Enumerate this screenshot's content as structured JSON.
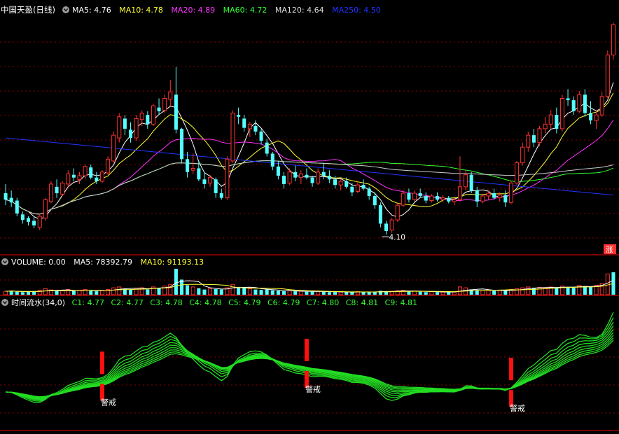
{
  "header": {
    "stock_name": "中国天盈(日线)",
    "ma_items": [
      {
        "label": "MA5: 4.76",
        "color": "#ffffff"
      },
      {
        "label": "MA10: 4.78",
        "color": "#ffff33"
      },
      {
        "label": "MA20: 4.89",
        "color": "#ff33ff"
      },
      {
        "label": "MA60: 4.72",
        "color": "#33ff33"
      },
      {
        "label": "MA120: 4.64",
        "color": "#dddddd"
      },
      {
        "label": "MA250: 4.50",
        "color": "#2233ff"
      }
    ]
  },
  "volume_header": {
    "title": "VOLUME: 0.00",
    "items": [
      {
        "label": "MA5: 78392.79",
        "color": "#ffffff"
      },
      {
        "label": "MA10: 91193.13",
        "color": "#ffff33"
      }
    ]
  },
  "indicator_header": {
    "title": "时间流水(34,0)",
    "items": [
      {
        "label": "C1: 4.77",
        "color": "#33ff33"
      },
      {
        "label": "C2: 4.77",
        "color": "#33ff33"
      },
      {
        "label": "C3: 4.78",
        "color": "#33ff33"
      },
      {
        "label": "C4: 4.78",
        "color": "#33ff33"
      },
      {
        "label": "C5: 4.79",
        "color": "#33ff33"
      },
      {
        "label": "C6: 4.79",
        "color": "#33ff33"
      },
      {
        "label": "C7: 4.80",
        "color": "#33ff33"
      },
      {
        "label": "C8: 4.81",
        "color": "#33ff33"
      },
      {
        "label": "C9: 4.81",
        "color": "#33ff33"
      }
    ]
  },
  "zhang_badge": "涨",
  "low_marker": "4.10",
  "colors": {
    "up": "#ff3232",
    "down": "#54ffff",
    "grid": "#8b0000",
    "ind": "#22dd22"
  },
  "chart_data": {
    "type": "candlestick",
    "ylim": [
      3.95,
      6.45
    ],
    "candles": [
      [
        4.55,
        4.65,
        4.42,
        4.48
      ],
      [
        4.5,
        4.58,
        4.4,
        4.45
      ],
      [
        4.47,
        4.5,
        4.3,
        4.33
      ],
      [
        4.32,
        4.35,
        4.22,
        4.26
      ],
      [
        4.28,
        4.3,
        4.2,
        4.24
      ],
      [
        4.25,
        4.3,
        4.17,
        4.2
      ],
      [
        4.18,
        4.33,
        4.15,
        4.3
      ],
      [
        4.28,
        4.5,
        4.25,
        4.48
      ],
      [
        4.46,
        4.68,
        4.44,
        4.65
      ],
      [
        4.62,
        4.7,
        4.5,
        4.55
      ],
      [
        4.54,
        4.68,
        4.52,
        4.66
      ],
      [
        4.65,
        4.8,
        4.62,
        4.76
      ],
      [
        4.75,
        4.82,
        4.68,
        4.72
      ],
      [
        4.7,
        4.78,
        4.65,
        4.74
      ],
      [
        4.74,
        4.86,
        4.7,
        4.84
      ],
      [
        4.83,
        4.86,
        4.7,
        4.72
      ],
      [
        4.72,
        4.78,
        4.65,
        4.68
      ],
      [
        4.68,
        4.8,
        4.66,
        4.78
      ],
      [
        4.77,
        4.95,
        4.75,
        4.92
      ],
      [
        4.9,
        5.22,
        4.88,
        5.18
      ],
      [
        5.15,
        5.42,
        5.1,
        5.38
      ],
      [
        5.36,
        5.4,
        5.18,
        5.25
      ],
      [
        5.24,
        5.32,
        5.1,
        5.15
      ],
      [
        5.15,
        5.4,
        5.12,
        5.36
      ],
      [
        5.35,
        5.45,
        5.28,
        5.42
      ],
      [
        5.4,
        5.44,
        5.25,
        5.3
      ],
      [
        5.3,
        5.52,
        5.28,
        5.5
      ],
      [
        5.48,
        5.58,
        5.4,
        5.44
      ],
      [
        5.45,
        5.62,
        5.42,
        5.58
      ],
      [
        5.57,
        5.78,
        5.5,
        5.65
      ],
      [
        5.62,
        5.92,
        5.2,
        5.24
      ],
      [
        5.25,
        5.26,
        4.88,
        4.92
      ],
      [
        4.92,
        5.0,
        4.72,
        4.78
      ],
      [
        4.8,
        4.98,
        4.76,
        4.82
      ],
      [
        4.82,
        4.9,
        4.68,
        4.7
      ],
      [
        4.7,
        4.78,
        4.6,
        4.65
      ],
      [
        4.66,
        4.75,
        4.62,
        4.72
      ],
      [
        4.7,
        4.72,
        4.5,
        4.55
      ],
      [
        4.55,
        4.6,
        4.48,
        4.5
      ],
      [
        4.5,
        4.95,
        4.48,
        4.92
      ],
      [
        4.9,
        5.45,
        4.88,
        5.42
      ],
      [
        5.4,
        5.48,
        5.3,
        5.38
      ],
      [
        5.36,
        5.4,
        5.22,
        5.26
      ],
      [
        5.25,
        5.32,
        5.16,
        5.3
      ],
      [
        5.28,
        5.34,
        5.18,
        5.22
      ],
      [
        5.22,
        5.25,
        5.08,
        5.12
      ],
      [
        5.1,
        5.14,
        4.95,
        4.98
      ],
      [
        4.98,
        5.0,
        4.8,
        4.84
      ],
      [
        4.84,
        4.9,
        4.7,
        4.74
      ],
      [
        4.74,
        4.78,
        4.6,
        4.65
      ],
      [
        4.66,
        4.82,
        4.64,
        4.78
      ],
      [
        4.78,
        4.85,
        4.68,
        4.72
      ],
      [
        4.72,
        4.8,
        4.65,
        4.76
      ],
      [
        4.75,
        4.82,
        4.7,
        4.72
      ],
      [
        4.72,
        4.74,
        4.62,
        4.66
      ],
      [
        4.66,
        4.82,
        4.64,
        4.78
      ],
      [
        4.78,
        4.88,
        4.7,
        4.74
      ],
      [
        4.74,
        4.8,
        4.66,
        4.7
      ],
      [
        4.7,
        4.74,
        4.6,
        4.64
      ],
      [
        4.64,
        4.7,
        4.58,
        4.68
      ],
      [
        4.68,
        4.72,
        4.6,
        4.62
      ],
      [
        4.62,
        4.66,
        4.52,
        4.56
      ],
      [
        4.57,
        4.68,
        4.55,
        4.64
      ],
      [
        4.64,
        4.7,
        4.58,
        4.6
      ],
      [
        4.6,
        4.62,
        4.48,
        4.52
      ],
      [
        4.52,
        4.56,
        4.38,
        4.42
      ],
      [
        4.42,
        4.45,
        4.18,
        4.22
      ],
      [
        4.22,
        4.25,
        4.1,
        4.14
      ],
      [
        4.15,
        4.28,
        4.12,
        4.26
      ],
      [
        4.26,
        4.45,
        4.24,
        4.42
      ],
      [
        4.42,
        4.58,
        4.4,
        4.55
      ],
      [
        4.55,
        4.6,
        4.45,
        4.48
      ],
      [
        4.48,
        4.58,
        4.46,
        4.55
      ],
      [
        4.55,
        4.6,
        4.5,
        4.52
      ],
      [
        4.52,
        4.56,
        4.44,
        4.47
      ],
      [
        4.47,
        4.54,
        4.45,
        4.52
      ],
      [
        4.52,
        4.56,
        4.46,
        4.48
      ],
      [
        4.48,
        4.53,
        4.45,
        4.5
      ],
      [
        4.5,
        4.52,
        4.44,
        4.46
      ],
      [
        4.46,
        4.5,
        4.42,
        4.48
      ],
      [
        4.48,
        4.95,
        4.46,
        4.62
      ],
      [
        4.62,
        4.8,
        4.58,
        4.75
      ],
      [
        4.75,
        4.78,
        4.55,
        4.58
      ],
      [
        4.58,
        4.62,
        4.4,
        4.46
      ],
      [
        4.46,
        4.54,
        4.44,
        4.52
      ],
      [
        4.52,
        4.58,
        4.48,
        4.55
      ],
      [
        4.55,
        4.6,
        4.48,
        4.5
      ],
      [
        4.5,
        4.56,
        4.46,
        4.53
      ],
      [
        4.53,
        4.58,
        4.4,
        4.45
      ],
      [
        4.45,
        4.68,
        4.43,
        4.66
      ],
      [
        4.66,
        4.9,
        4.64,
        4.88
      ],
      [
        4.88,
        5.1,
        4.85,
        5.05
      ],
      [
        5.05,
        5.22,
        5.0,
        5.18
      ],
      [
        5.18,
        5.25,
        5.05,
        5.1
      ],
      [
        5.1,
        5.28,
        5.06,
        5.25
      ],
      [
        5.25,
        5.38,
        5.2,
        5.3
      ],
      [
        5.3,
        5.45,
        5.25,
        5.4
      ],
      [
        5.4,
        5.48,
        5.2,
        5.25
      ],
      [
        5.25,
        5.62,
        5.22,
        5.58
      ],
      [
        5.58,
        5.68,
        5.5,
        5.56
      ],
      [
        5.56,
        5.6,
        5.4,
        5.44
      ],
      [
        5.44,
        5.66,
        5.42,
        5.62
      ],
      [
        5.62,
        5.68,
        5.38,
        5.42
      ],
      [
        5.42,
        5.55,
        5.3,
        5.34
      ],
      [
        5.34,
        5.45,
        5.25,
        5.4
      ],
      [
        5.4,
        5.65,
        5.38,
        5.6
      ],
      [
        5.6,
        6.1,
        5.58,
        6.05
      ],
      [
        6.05,
        6.4,
        6.0,
        6.38
      ]
    ],
    "volume": [
      [
        8,
        1
      ],
      [
        9,
        0
      ],
      [
        7,
        0
      ],
      [
        6,
        0
      ],
      [
        8,
        0
      ],
      [
        7,
        0
      ],
      [
        10,
        1
      ],
      [
        14,
        1
      ],
      [
        11,
        1
      ],
      [
        9,
        0
      ],
      [
        10,
        1
      ],
      [
        12,
        1
      ],
      [
        9,
        0
      ],
      [
        10,
        1
      ],
      [
        12,
        1
      ],
      [
        9,
        0
      ],
      [
        8,
        0
      ],
      [
        9,
        1
      ],
      [
        12,
        1
      ],
      [
        16,
        1
      ],
      [
        18,
        1
      ],
      [
        14,
        0
      ],
      [
        12,
        0
      ],
      [
        15,
        1
      ],
      [
        16,
        1
      ],
      [
        12,
        0
      ],
      [
        18,
        1
      ],
      [
        16,
        0
      ],
      [
        20,
        1
      ],
      [
        24,
        1
      ],
      [
        60,
        0
      ],
      [
        35,
        0
      ],
      [
        22,
        0
      ],
      [
        18,
        1
      ],
      [
        15,
        0
      ],
      [
        12,
        0
      ],
      [
        14,
        1
      ],
      [
        13,
        0
      ],
      [
        12,
        0
      ],
      [
        16,
        1
      ],
      [
        24,
        1
      ],
      [
        18,
        0
      ],
      [
        15,
        0
      ],
      [
        14,
        1
      ],
      [
        12,
        0
      ],
      [
        11,
        0
      ],
      [
        12,
        0
      ],
      [
        10,
        0
      ],
      [
        9,
        0
      ],
      [
        8,
        0
      ],
      [
        9,
        1
      ],
      [
        8,
        0
      ],
      [
        8,
        1
      ],
      [
        7,
        0
      ],
      [
        7,
        0
      ],
      [
        8,
        1
      ],
      [
        7,
        0
      ],
      [
        6,
        0
      ],
      [
        6,
        0
      ],
      [
        6,
        1
      ],
      [
        6,
        0
      ],
      [
        6,
        0
      ],
      [
        7,
        1
      ],
      [
        6,
        0
      ],
      [
        6,
        0
      ],
      [
        7,
        0
      ],
      [
        9,
        0
      ],
      [
        8,
        0
      ],
      [
        8,
        1
      ],
      [
        9,
        1
      ],
      [
        10,
        1
      ],
      [
        8,
        0
      ],
      [
        8,
        1
      ],
      [
        7,
        0
      ],
      [
        6,
        0
      ],
      [
        7,
        1
      ],
      [
        6,
        0
      ],
      [
        6,
        1
      ],
      [
        6,
        0
      ],
      [
        6,
        1
      ],
      [
        18,
        1
      ],
      [
        16,
        1
      ],
      [
        12,
        0
      ],
      [
        11,
        0
      ],
      [
        10,
        1
      ],
      [
        10,
        1
      ],
      [
        9,
        0
      ],
      [
        10,
        1
      ],
      [
        9,
        0
      ],
      [
        12,
        1
      ],
      [
        14,
        1
      ],
      [
        16,
        1
      ],
      [
        18,
        1
      ],
      [
        16,
        0
      ],
      [
        17,
        1
      ],
      [
        16,
        1
      ],
      [
        18,
        1
      ],
      [
        16,
        0
      ],
      [
        20,
        1
      ],
      [
        18,
        0
      ],
      [
        16,
        0
      ],
      [
        22,
        1
      ],
      [
        20,
        0
      ],
      [
        18,
        0
      ],
      [
        22,
        1
      ],
      [
        26,
        1
      ],
      [
        48,
        1
      ],
      [
        52,
        0
      ]
    ],
    "warnings": [
      {
        "index": 17,
        "label": "警戒"
      },
      {
        "index": 53,
        "label": "警戒"
      },
      {
        "index": 89,
        "label": "警戒"
      }
    ]
  }
}
